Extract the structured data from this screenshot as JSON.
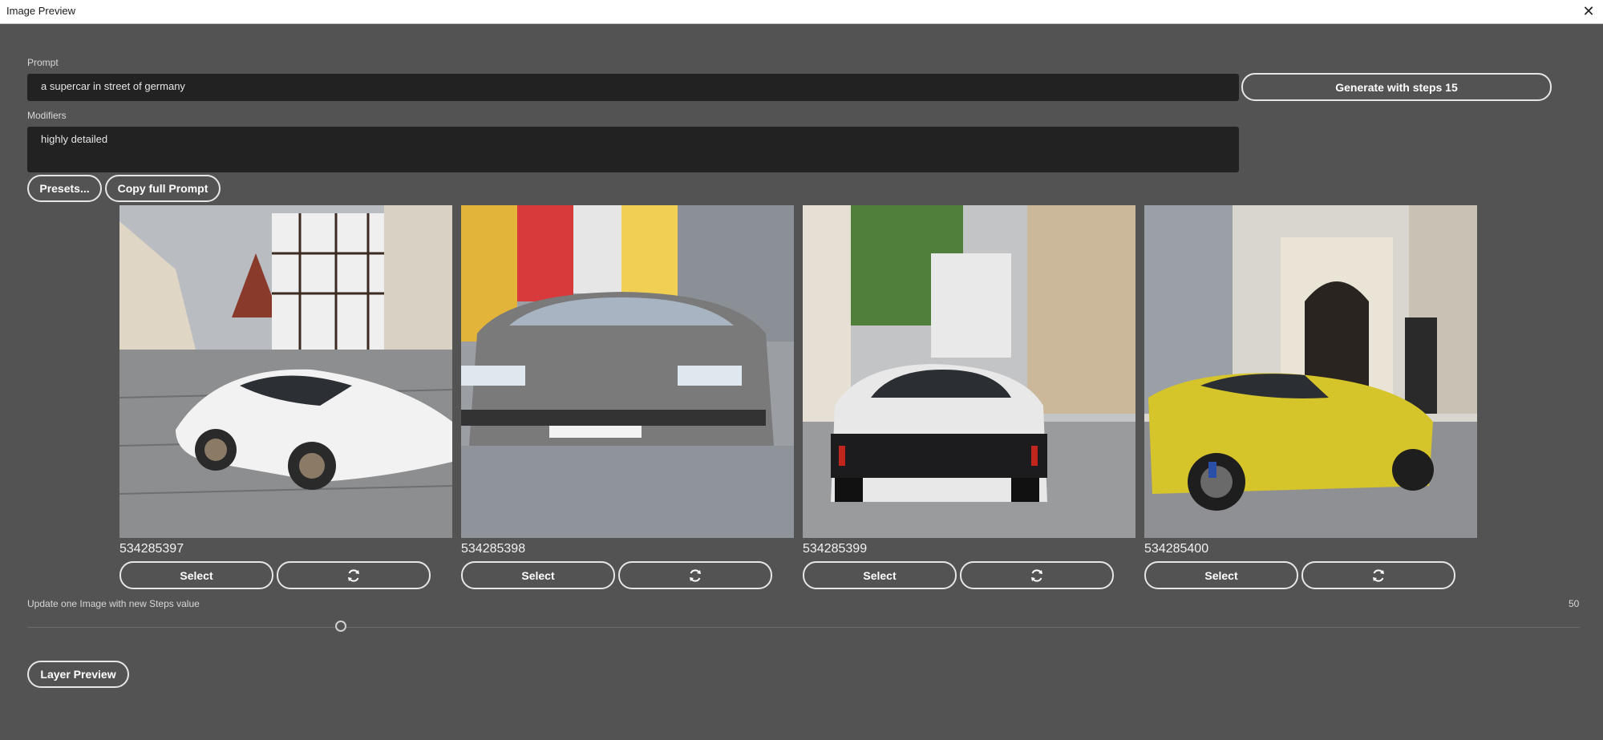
{
  "window": {
    "title": "Image Preview",
    "close_glyph": "✕"
  },
  "prompt": {
    "label": "Prompt",
    "value": "a supercar in street of germany"
  },
  "generate_button": {
    "label": "Generate with steps 15"
  },
  "modifiers": {
    "label": "Modifiers",
    "value": "highly detailed"
  },
  "presets_button": {
    "label": "Presets..."
  },
  "copy_prompt_button": {
    "label": "Copy full Prompt"
  },
  "images": [
    {
      "seed": "534285397",
      "select_label": "Select",
      "refresh_icon": "refresh-icon",
      "car_color": "#f2f2f2"
    },
    {
      "seed": "534285398",
      "select_label": "Select",
      "refresh_icon": "refresh-icon",
      "car_color": "#7a7a7a"
    },
    {
      "seed": "534285399",
      "select_label": "Select",
      "refresh_icon": "refresh-icon",
      "car_color": "#e8e8e8"
    },
    {
      "seed": "534285400",
      "select_label": "Select",
      "refresh_icon": "refresh-icon",
      "car_color": "#d6c52a"
    }
  ],
  "steps_slider": {
    "label": "Update one Image with new Steps value",
    "max_value": "50",
    "value": 15
  },
  "layer_preview_button": {
    "label": "Layer Preview"
  },
  "colors": {
    "background": "#535353",
    "field": "#222222",
    "button_border": "#e6e6e6"
  }
}
